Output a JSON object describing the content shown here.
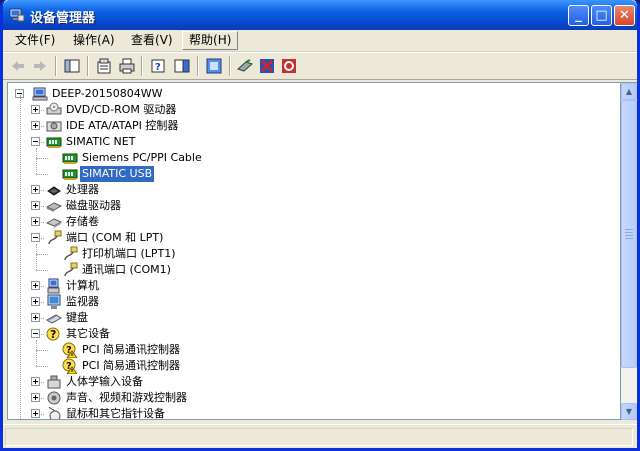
{
  "window": {
    "title": "设备管理器",
    "colors": {
      "titlebar": "#0a5fdf",
      "selection": "#316ac5",
      "frame": "#0831d9"
    }
  },
  "menu": [
    {
      "label": "文件",
      "accel": "(F)"
    },
    {
      "label": "操作",
      "accel": "(A)"
    },
    {
      "label": "查看",
      "accel": "(V)"
    },
    {
      "label": "帮助",
      "accel": "(H)"
    }
  ],
  "toolbar": {
    "buttons": [
      "back-icon",
      "forward-icon",
      "console-tree-icon",
      "properties-icon",
      "print-icon",
      "help-icon",
      "show-hide-icon",
      "scan-hardware-icon",
      "update-driver-icon",
      "uninstall-icon",
      "disable-icon"
    ]
  },
  "tree": {
    "root": "DEEP-20150804WW",
    "items": [
      {
        "label": "DVD/CD-ROM 驱动器",
        "icon": "dvd-drive-icon",
        "state": "collapsed"
      },
      {
        "label": "IDE ATA/ATAPI 控制器",
        "icon": "ide-controller-icon",
        "state": "collapsed"
      },
      {
        "label": "SIMATIC NET",
        "icon": "network-card-icon",
        "state": "expanded"
      },
      {
        "label": "Siemens PC/PPI Cable",
        "icon": "network-card-icon",
        "child": true
      },
      {
        "label": "SIMATIC USB",
        "icon": "network-card-icon",
        "child": true,
        "selected": true
      },
      {
        "label": "处理器",
        "icon": "processor-icon",
        "state": "collapsed"
      },
      {
        "label": "磁盘驱动器",
        "icon": "disk-drive-icon",
        "state": "collapsed"
      },
      {
        "label": "存储卷",
        "icon": "storage-volume-icon",
        "state": "collapsed"
      },
      {
        "label": "端口 (COM 和 LPT)",
        "icon": "port-icon",
        "state": "expanded"
      },
      {
        "label": "打印机端口 (LPT1)",
        "icon": "port-icon",
        "child": true
      },
      {
        "label": "通讯端口 (COM1)",
        "icon": "port-icon",
        "child": true
      },
      {
        "label": "计算机",
        "icon": "computer-icon",
        "state": "collapsed"
      },
      {
        "label": "监视器",
        "icon": "monitor-icon",
        "state": "collapsed"
      },
      {
        "label": "键盘",
        "icon": "keyboard-icon",
        "state": "collapsed"
      },
      {
        "label": "其它设备",
        "icon": "unknown-device-icon",
        "state": "expanded"
      },
      {
        "label": "PCI 简易通讯控制器",
        "icon": "unknown-device-warning-icon",
        "child": true
      },
      {
        "label": "PCI 简易通讯控制器",
        "icon": "unknown-device-warning-icon",
        "child": true
      },
      {
        "label": "人体学输入设备",
        "icon": "hid-icon",
        "state": "collapsed"
      },
      {
        "label": "声音、视频和游戏控制器",
        "icon": "sound-icon",
        "state": "collapsed"
      },
      {
        "label": "鼠标和其它指针设备",
        "icon": "mouse-icon",
        "state": "collapsed"
      }
    ]
  },
  "status": {
    "text": ""
  }
}
